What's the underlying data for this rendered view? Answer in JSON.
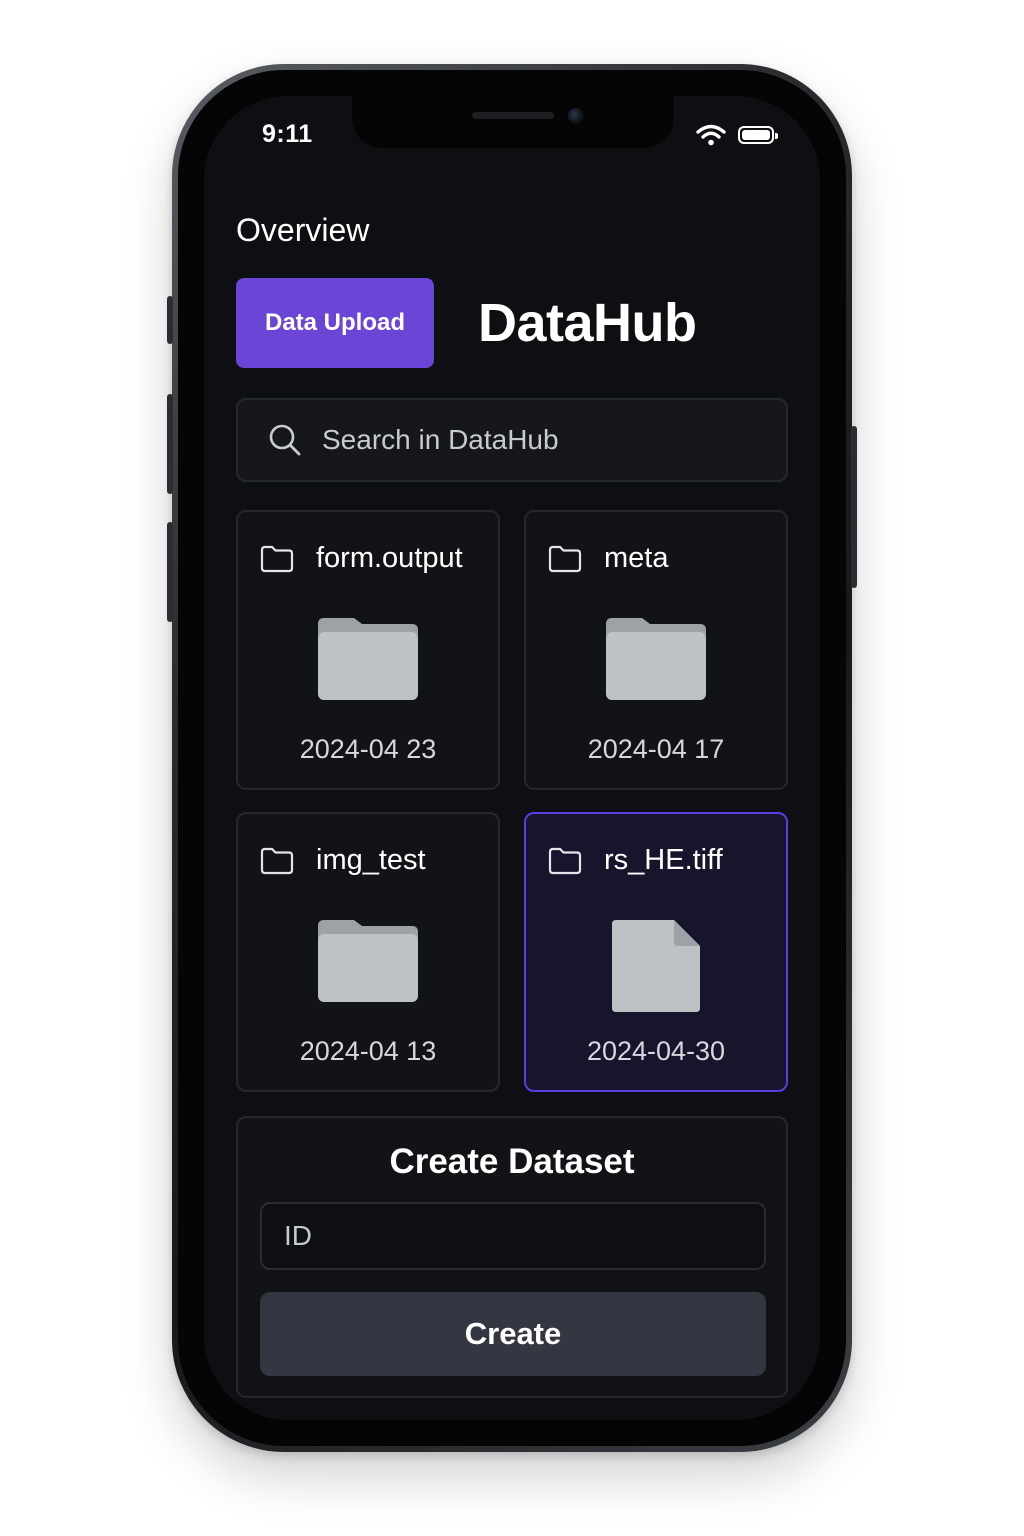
{
  "status_bar": {
    "time": "9:11",
    "wifi_icon": "wifi-icon",
    "battery_icon": "battery-icon"
  },
  "header": {
    "section_title": "Overview",
    "upload_button_label": "Data Upload",
    "app_name": "DataHub"
  },
  "search": {
    "placeholder": "Search in DataHub",
    "icon": "search-icon"
  },
  "items": [
    {
      "name": "form.output",
      "date": "2024-04 23",
      "kind": "folder",
      "selected": false
    },
    {
      "name": "meta",
      "date": "2024-04 17",
      "kind": "folder",
      "selected": false
    },
    {
      "name": "img_test",
      "date": "2024-04 13",
      "kind": "folder",
      "selected": false
    },
    {
      "name": "rs_HE.tiff",
      "date": "2024-04-30",
      "kind": "file",
      "selected": true
    }
  ],
  "create_dataset": {
    "title": "Create Dataset",
    "id_placeholder": "ID",
    "button_label": "Create"
  },
  "colors": {
    "accent": "#6a45d6",
    "selected_border": "#5d3ce0",
    "screen_background": "#0e0f12",
    "card_background": "#121317",
    "icon_fill": "#bfc2c5",
    "create_button": "#343741"
  }
}
